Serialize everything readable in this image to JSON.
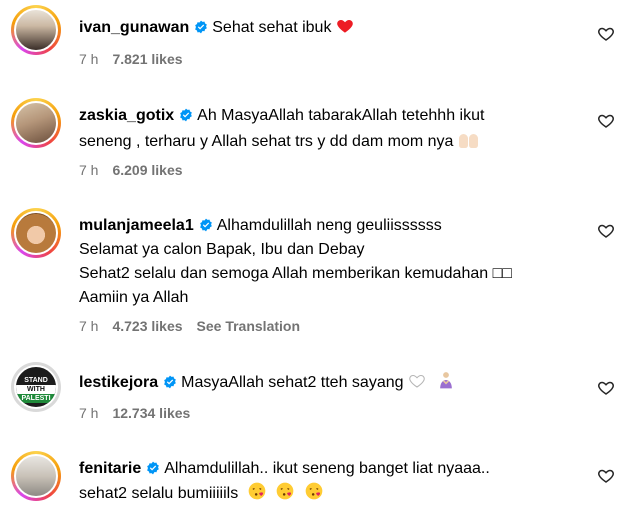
{
  "comments": [
    {
      "username": "ivan_gunawan",
      "lines": [
        "Sehat sehat ibuk"
      ],
      "time": "7 h",
      "likes": "7.821 likes",
      "translation": ""
    },
    {
      "username": "zaskia_gotix",
      "lines": [
        "Ah MasyaAllah tabarakAllah tetehhh ikut",
        "seneng , terharu y Allah sehat trs y dd dam mom nya"
      ],
      "time": "7 h",
      "likes": "6.209 likes",
      "translation": ""
    },
    {
      "username": "mulanjameela1",
      "lines": [
        "Alhamdulillah neng geuliissssss",
        "Selamat ya calon Bapak, Ibu dan Debay",
        "Sehat2 selalu dan semoga Allah memberikan kemudahan □□",
        "Aamiin ya Allah"
      ],
      "time": "7 h",
      "likes": "4.723 likes",
      "translation": "See Translation"
    },
    {
      "username": "lestikejora",
      "lines": [
        "MasyaAllah sehat2 tteh sayang"
      ],
      "time": "7 h",
      "likes": "12.734 likes",
      "translation": ""
    },
    {
      "username": "fenitarie",
      "lines": [
        "Alhamdulillah.. ikut seneng banget liat nyaaa..",
        "sehat2 selalu bumiiiiils"
      ],
      "time": "",
      "likes": "",
      "translation": ""
    }
  ],
  "avatar_text": {
    "lestikejora": [
      "STAND",
      "WITH",
      "PALESTI"
    ]
  },
  "colors": {
    "verified": "#0095f6",
    "meta": "#737373",
    "heart_red": "#ed1c24"
  },
  "icons": {
    "like": "heart-outline-icon",
    "verified": "verified-badge-icon"
  }
}
